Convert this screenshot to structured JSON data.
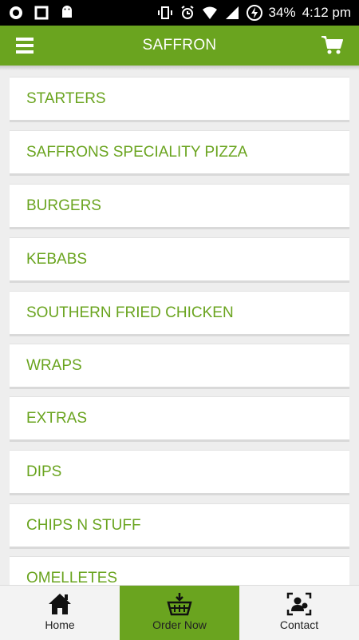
{
  "status_bar": {
    "battery": "34%",
    "time": "4:12 pm",
    "left_icons": [
      "notification-a-icon",
      "square-icon",
      "android-icon"
    ],
    "right_icons": [
      "vibrate-icon",
      "alarm-icon",
      "wifi-icon",
      "signal-icon",
      "battery-charging-icon"
    ]
  },
  "header": {
    "title": "SAFFRON",
    "menu_icon": "hamburger-menu-icon",
    "cart_icon": "shopping-cart-icon"
  },
  "menu": {
    "items": [
      {
        "label": "STARTERS"
      },
      {
        "label": "SAFFRONS SPECIALITY PIZZA"
      },
      {
        "label": "BURGERS"
      },
      {
        "label": "KEBABS"
      },
      {
        "label": "SOUTHERN FRIED CHICKEN"
      },
      {
        "label": "WRAPS"
      },
      {
        "label": "EXTRAS"
      },
      {
        "label": "DIPS"
      },
      {
        "label": "CHIPS N STUFF"
      },
      {
        "label": "OMELLETES"
      }
    ]
  },
  "bottom_nav": {
    "tabs": [
      {
        "label": "Home",
        "icon": "home-icon"
      },
      {
        "label": "Order Now",
        "icon": "basket-icon",
        "active": true
      },
      {
        "label": "Contact",
        "icon": "contact-card-icon"
      }
    ]
  },
  "colors": {
    "brand_green": "#6aa41f",
    "status_bar": "#000000",
    "background": "#eeeeee"
  }
}
